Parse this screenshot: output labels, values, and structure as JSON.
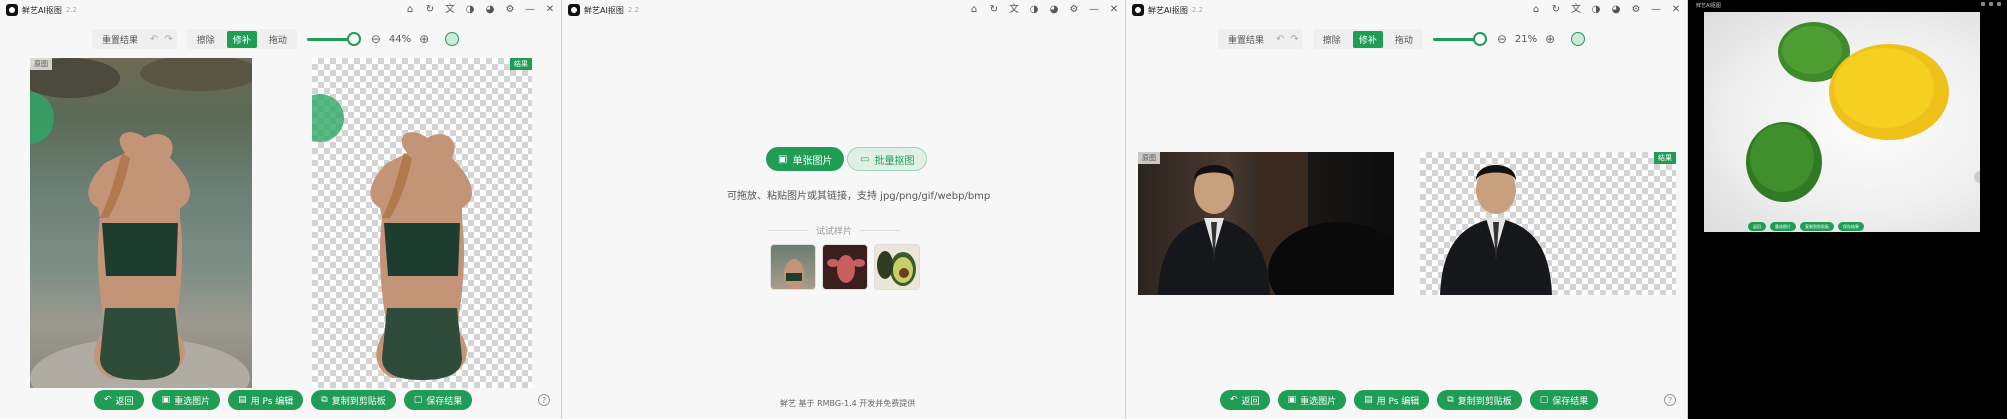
{
  "app": {
    "title": "鲜艺AI抠图",
    "version": "2.2"
  },
  "titlebar_icons": [
    "home-icon",
    "sync-icon",
    "translate-icon",
    "contrast-icon",
    "palette-icon",
    "settings-icon",
    "minimize-icon",
    "close-icon"
  ],
  "toolbar": {
    "reset_label": "重置结果",
    "undo_glyph": "↶",
    "redo_glyph": "↷",
    "modes": [
      "擦除",
      "修补",
      "拖动"
    ],
    "active_mode": "修补",
    "zoom_out_glyph": "⊖",
    "zoom_in_glyph": "⊕"
  },
  "window1": {
    "zoom": "44%",
    "brush_size": 0.85,
    "tag_original": "原图",
    "tag_result": "结果"
  },
  "window3": {
    "zoom": "21%",
    "brush_size": 0.85,
    "tag_original": "原图",
    "tag_result": "结果"
  },
  "actions": {
    "back": "返回",
    "reselect": "重选图片",
    "open_ps": "用 Ps 编辑",
    "copy": "复制到剪贴板",
    "save": "保存结果"
  },
  "window2": {
    "single_label": "单张图片",
    "batch_label": "批量抠图",
    "hint": "可拖放、粘贴图片或其链接，支持 jpg/png/gif/webp/bmp",
    "try_label": "试试样片",
    "footer": "鲜艺  基于 RMBG-1.4 开发并免费提供"
  },
  "window4": {
    "title": "鲜艺AI抠图",
    "mini_actions": [
      "返回",
      "重选图片",
      "复制到剪贴板",
      "保存结果"
    ]
  },
  "colors": {
    "accent": "#1f9d55",
    "background": "#f7f7f7"
  }
}
